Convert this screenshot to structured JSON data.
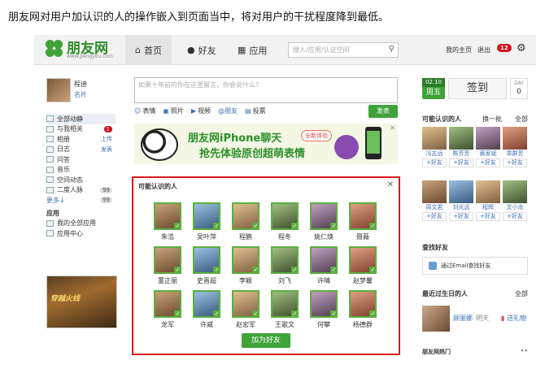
{
  "caption": "朋友网对用户加认识的人的操作嵌入到页面当中，将对用户的干扰程度降到最低。",
  "header": {
    "logo_text": "朋友网",
    "logo_url": "www.pengyou.com",
    "nav": [
      {
        "label": "首页",
        "icon": "home-icon"
      },
      {
        "label": "好友",
        "icon": "person-icon"
      },
      {
        "label": "应用",
        "icon": "apps-icon"
      }
    ],
    "search_placeholder": "搜人/应用/认证空间",
    "my_home": "我的主页",
    "logout": "退出",
    "notif_count": "12"
  },
  "sidebar": {
    "user_name": "程迪",
    "card_label": "名片",
    "items": [
      {
        "label": "全部动静",
        "extra": ""
      },
      {
        "label": "与我相关",
        "extra": "1"
      },
      {
        "label": "相册",
        "extra": "上传"
      },
      {
        "label": "日志",
        "extra": "发表"
      },
      {
        "label": "问答",
        "extra": ""
      },
      {
        "label": "音乐",
        "extra": ""
      },
      {
        "label": "空间动态",
        "extra": ""
      },
      {
        "label": "二度人脉",
        "extra": "99"
      },
      {
        "label": "更多↓",
        "extra": "99"
      }
    ],
    "apps_section": "应用",
    "apps": [
      {
        "label": "我的全部应用"
      },
      {
        "label": "应用中心"
      }
    ],
    "game_title": "穿越火线"
  },
  "composer": {
    "placeholder": "如果十年前的你在这里留言，你会说什么？",
    "tools": [
      "表情",
      "照片",
      "视频",
      "@朋友",
      "投票"
    ],
    "publish": "发表"
  },
  "banner": {
    "line1": "朋友网iPhone聊天",
    "line2": "抢先体验原创超萌表情",
    "badge": "全新体验"
  },
  "popup": {
    "title": "可能认识的人",
    "people": [
      "朱浩",
      "吴叶萍",
      "程鹏",
      "程冬",
      "姚仁焕",
      "聂薇",
      "董正丽",
      "史晋超",
      "李颖",
      "刘飞",
      "许晴",
      "赵梦馨",
      "龙军",
      "许威",
      "赵宏军",
      "王歌文",
      "何攀",
      "杨德群"
    ],
    "add_button": "加为好友"
  },
  "right": {
    "date_top": "02.10",
    "date_bottom": "周五",
    "signin": "签到",
    "day_label": "DAY",
    "day_value": "0",
    "pymk_title": "可能认识的人",
    "pymk_switch": "换一批",
    "pymk_all": "全部",
    "pymk": [
      "冯志远",
      "陈芳芳",
      "黄家斌",
      "章群芳",
      "周文君",
      "刘光远",
      "程辉",
      "文小龙"
    ],
    "add_friend": "+好友",
    "find_title": "查找好友",
    "email_find": "通过Email查找好友",
    "bday_title": "最近过生日的人",
    "bday_all": "全部",
    "bday_name": "顾丽娜",
    "bday_day": "明天",
    "gift": "送礼物",
    "hot_title": "朋友网热门"
  }
}
